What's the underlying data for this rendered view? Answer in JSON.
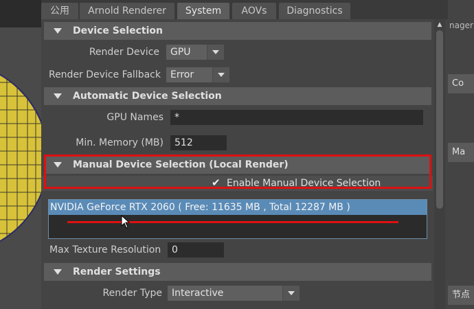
{
  "tabs": [
    {
      "label": "公用",
      "active": false
    },
    {
      "label": "Arnold Renderer",
      "active": false
    },
    {
      "label": "System",
      "active": true
    },
    {
      "label": "AOVs",
      "active": false
    },
    {
      "label": "Diagnostics",
      "active": false
    }
  ],
  "sections": {
    "device_selection": "Device Selection",
    "automatic_device_selection": "Automatic Device Selection",
    "manual_device_selection": "Manual Device Selection (Local Render)",
    "render_settings": "Render Settings"
  },
  "fields": {
    "render_device": {
      "label": "Render Device",
      "value": "GPU"
    },
    "render_device_fallback": {
      "label": "Render Device Fallback",
      "value": "Error"
    },
    "gpu_names": {
      "label": "GPU Names",
      "value": "*"
    },
    "min_memory": {
      "label": "Min. Memory (MB)",
      "value": "512"
    },
    "max_texture_resolution": {
      "label": "Max Texture Resolution",
      "value": "0"
    },
    "render_type": {
      "label": "Render Type",
      "value": "Interactive"
    }
  },
  "manual_selection": {
    "checkbox_label": "Enable Manual Device Selection",
    "checked": true,
    "check_glyph": "✔",
    "devices": [
      "NVIDIA GeForce RTX 2060 ( Free: 11635 MB , Total 12287 MB )"
    ]
  },
  "right_panel": {
    "manager_text": "nager",
    "items": [
      "Co",
      "Ma",
      "节点"
    ]
  },
  "colors": {
    "highlight_red": "#e01010",
    "selection_blue": "#5a8bb7",
    "sphere_yellow": "#d8c23a"
  },
  "icons": {
    "section_toggle": "triangle-down-icon",
    "dropdown": "chevron-down-icon",
    "checkbox": "checkmark-icon",
    "cursor": "mouse-pointer-icon"
  }
}
